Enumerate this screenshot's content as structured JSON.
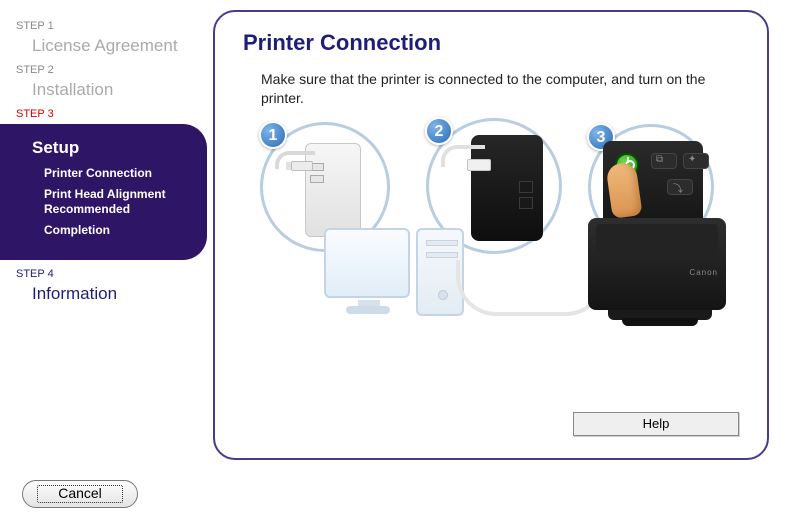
{
  "sidebar": {
    "step1": {
      "label": "STEP 1",
      "title": "License Agreement"
    },
    "step2": {
      "label": "STEP 2",
      "title": "Installation"
    },
    "step3": {
      "label": "STEP 3",
      "title": "Setup",
      "items": [
        "Printer Connection",
        "Print Head Alignment Recommended",
        "Completion"
      ]
    },
    "step4": {
      "label": "STEP 4",
      "title": "Information"
    }
  },
  "main": {
    "title": "Printer Connection",
    "text": "Make sure that the printer is connected to the computer, and turn on the printer.",
    "badges": [
      "1",
      "2",
      "3"
    ],
    "printer_brand": "Canon",
    "help_label": "Help"
  },
  "footer": {
    "cancel_label": "Cancel"
  }
}
